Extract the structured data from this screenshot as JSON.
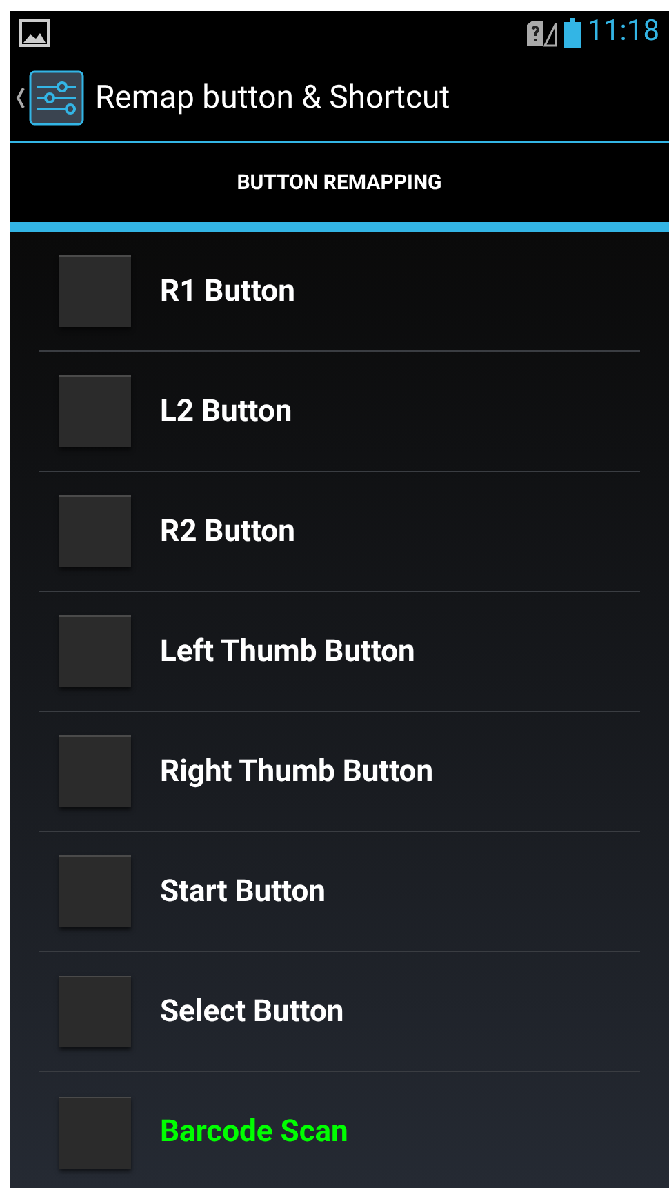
{
  "status_bar": {
    "time": "11:18"
  },
  "action_bar": {
    "title": "Remap button & Shortcut"
  },
  "tabs": [
    {
      "label": "BUTTON REMAPPING",
      "selected": true
    }
  ],
  "items": [
    {
      "label": "R1 Button",
      "checked": false,
      "color": "#ffffff"
    },
    {
      "label": "L2 Button",
      "checked": false,
      "color": "#ffffff"
    },
    {
      "label": "R2 Button",
      "checked": false,
      "color": "#ffffff"
    },
    {
      "label": "Left Thumb Button",
      "checked": false,
      "color": "#ffffff"
    },
    {
      "label": "Right Thumb Button",
      "checked": false,
      "color": "#ffffff"
    },
    {
      "label": "Start Button",
      "checked": false,
      "color": "#ffffff"
    },
    {
      "label": "Select Button",
      "checked": false,
      "color": "#ffffff"
    },
    {
      "label": "Barcode Scan",
      "checked": false,
      "color": "#00ff00"
    }
  ]
}
